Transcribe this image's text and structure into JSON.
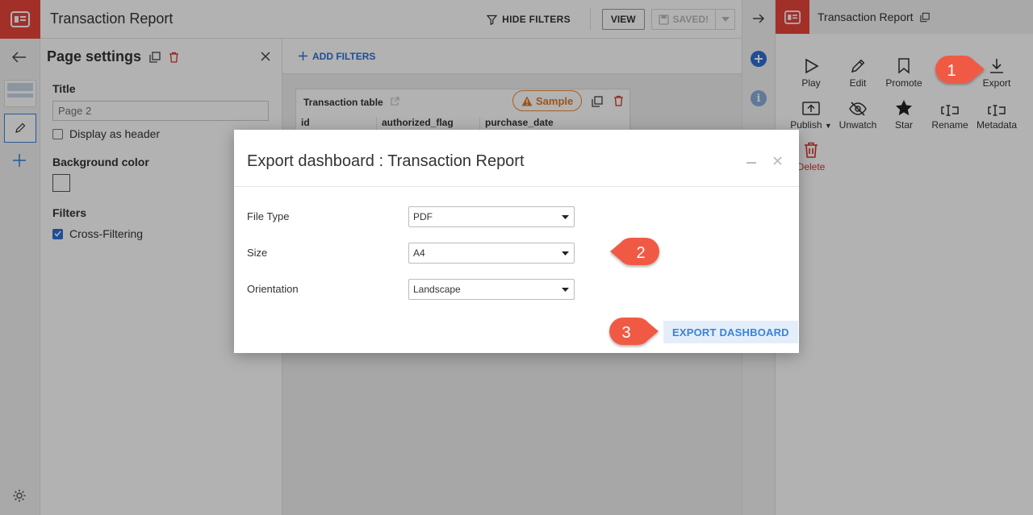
{
  "header": {
    "title": "Transaction Report",
    "hide_filters": "HIDE FILTERS",
    "view": "VIEW",
    "saved": "SAVED!"
  },
  "settings": {
    "title": "Page settings",
    "title_label": "Title",
    "title_placeholder": "Page 2",
    "display_header": "Display as header",
    "bg_label": "Background color",
    "filters_label": "Filters",
    "cross_filtering": "Cross-Filtering"
  },
  "canvas": {
    "add_filters": "ADD FILTERS",
    "tile": {
      "title": "Transaction table",
      "sample": "Sample",
      "columns": [
        "id",
        "authorized_flag",
        "purchase_date"
      ]
    }
  },
  "right": {
    "title": "Transaction Report",
    "actions": {
      "play": "Play",
      "edit": "Edit",
      "promote": "Promote",
      "export": "Export",
      "publish": "Publish",
      "unwatch": "Unwatch",
      "star": "Star",
      "rename": "Rename",
      "metadata": "Metadata",
      "delete": "Delete"
    }
  },
  "modal": {
    "title": "Export dashboard : Transaction Report",
    "file_type_label": "File Type",
    "file_type_value": "PDF",
    "size_label": "Size",
    "size_value": "A4",
    "orientation_label": "Orientation",
    "orientation_value": "Landscape",
    "export_button": "EXPORT DASHBOARD"
  },
  "callouts": [
    "1",
    "2",
    "3"
  ],
  "colors": {
    "brand_red": "#e8453c",
    "accent_blue": "#2f6fd6",
    "callout_red": "#f05a44",
    "sample_orange": "#e17a24"
  }
}
